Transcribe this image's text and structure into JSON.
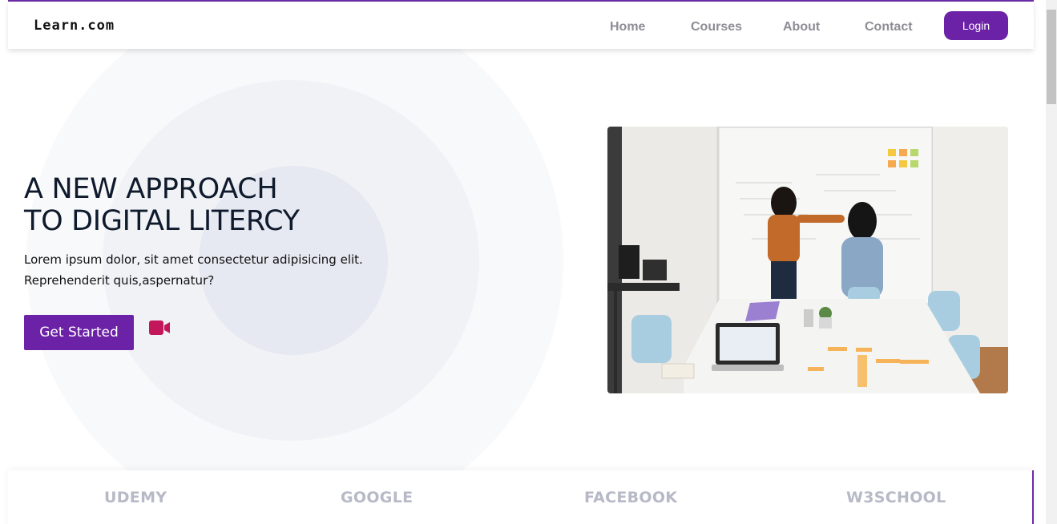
{
  "navbar": {
    "brand": "Learn.com",
    "links": [
      "Home",
      "Courses",
      "About",
      "Contact"
    ],
    "login_label": "Login"
  },
  "hero": {
    "title_line1": "A NEW APPROACH",
    "title_line2": "TO DIGITAL LITERCY",
    "desc_line1": "Lorem ipsum dolor, sit amet consectetur adipisicing elit.",
    "desc_line2": "Reprehenderit quis,aspernatur?",
    "cta_label": "Get Started"
  },
  "partners": [
    "UDEMY",
    "GOOGLE",
    "FACEBOOK",
    "W3SCHOOL"
  ],
  "colors": {
    "accent": "#6c22a6",
    "video_icon": "#c2185b",
    "title": "#0f1a2c",
    "nav_text": "#8d8d95",
    "partner_text": "#b7b9c6"
  }
}
